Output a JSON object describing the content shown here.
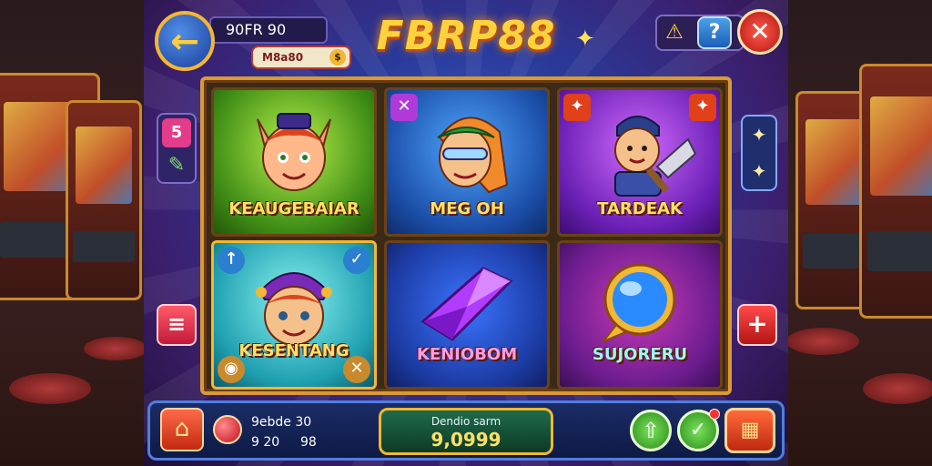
{
  "header": {
    "back_icon": "arrow-left-icon",
    "info_text": "90FR 90",
    "pill_text": "M8a80",
    "logo": "FBRP88",
    "warn_icon": "warning-icon",
    "help_label": "?",
    "close_label": "✕"
  },
  "side": {
    "left_top_icon": "5",
    "left_bottom_icon": "≡"
  },
  "games": [
    {
      "name": "KEAUGEBAIAR"
    },
    {
      "name": "MEG OH"
    },
    {
      "name": "TARDEAK"
    },
    {
      "name": "KESENTANG"
    },
    {
      "name": "KENIOBOM"
    },
    {
      "name": "SUJORERU"
    }
  ],
  "footer": {
    "balance_label": "9ebde 30",
    "balance_value_1": "9 20",
    "balance_value_2": "98",
    "center_label": "Dendio sarm",
    "center_value": "9,0999"
  },
  "colors": {
    "accent": "#f2b733",
    "brand": "#ffd23b",
    "frame_blue": "#2a3a9a",
    "panel_purple": "#3c1e6c"
  }
}
